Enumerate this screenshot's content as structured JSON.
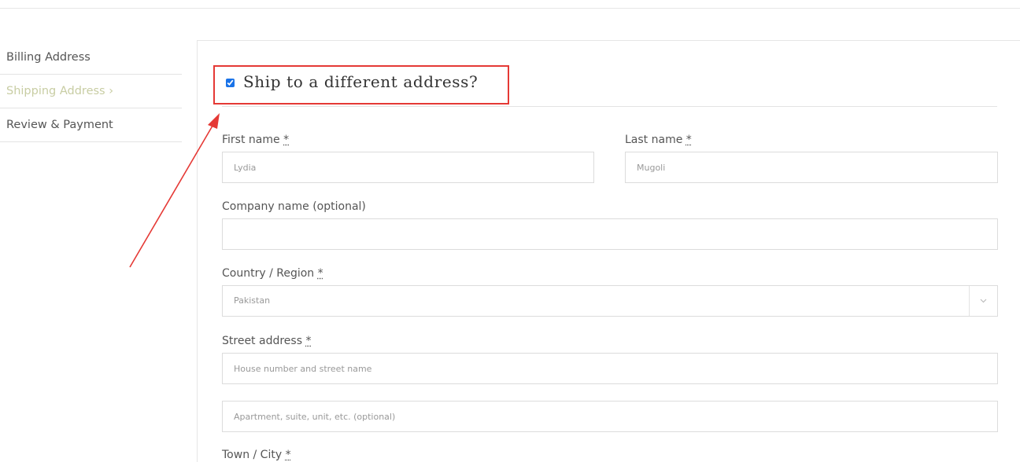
{
  "steps": [
    {
      "label": "Billing Address",
      "active": false
    },
    {
      "label": "Shipping Address ›",
      "active": true
    },
    {
      "label": "Review & Payment",
      "active": false
    }
  ],
  "shipping": {
    "checkbox_checked": true,
    "title": "Ship to a different address?"
  },
  "form": {
    "required_marker": "*",
    "first_name": {
      "label": "First name",
      "value": "Lydia"
    },
    "last_name": {
      "label": "Last name",
      "value": "Mugoli"
    },
    "company": {
      "label": "Company name (optional)",
      "value": ""
    },
    "country": {
      "label": "Country / Region",
      "value": "Pakistan"
    },
    "street": {
      "label": "Street address",
      "placeholder1": "House number and street name",
      "placeholder2": "Apartment, suite, unit, etc. (optional)"
    },
    "city": {
      "label": "Town / City"
    }
  },
  "colors": {
    "active_step": "#c8cda3",
    "highlight": "#e53935"
  },
  "icons": [
    "checkbox-icon",
    "chevron-down-icon",
    "annotation-arrow-icon"
  ]
}
